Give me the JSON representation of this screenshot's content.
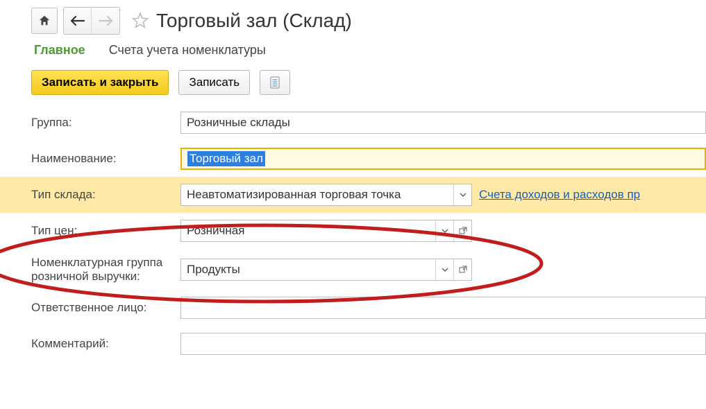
{
  "header": {
    "title": "Торговый зал (Склад)"
  },
  "tabs": {
    "main": "Главное",
    "accounts": "Счета учета номенклатуры"
  },
  "actions": {
    "save_close": "Записать и закрыть",
    "save": "Записать"
  },
  "form": {
    "group_label": "Группа:",
    "group_value": "Розничные склады",
    "name_label": "Наименование:",
    "name_value": "Торговый зал",
    "type_label": "Тип склада:",
    "type_value": "Неавтоматизированная торговая точка",
    "type_link": "Счета доходов и расходов пр",
    "price_label": "Тип цен:",
    "price_value": "Розничная",
    "nomgroup_label": "Номенклатурная группа розничной выручки:",
    "nomgroup_value": "Продукты",
    "responsible_label": "Ответственное лицо:",
    "responsible_value": "",
    "comment_label": "Комментарий:",
    "comment_value": ""
  }
}
